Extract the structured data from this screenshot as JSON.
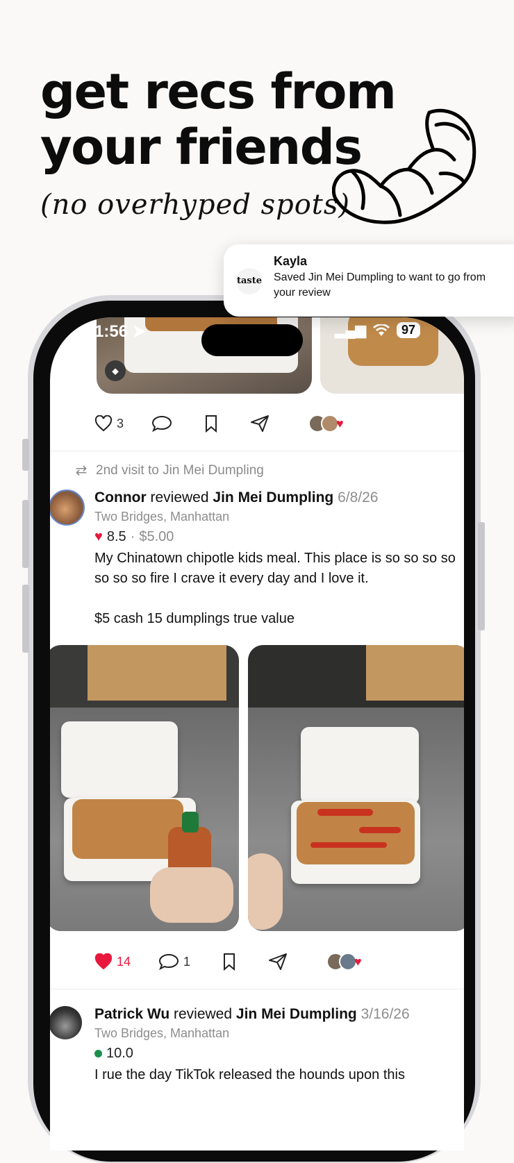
{
  "headline": {
    "line1": "get recs from",
    "line2": "your friends",
    "subline": "(no overhyped spots)"
  },
  "notification": {
    "app": "taste",
    "title": "Kayla",
    "message": "Saved Jin Mei Dumpling to want to go from your review"
  },
  "status_bar": {
    "time": "1:56",
    "battery": "97"
  },
  "first_post": {
    "likes": "3"
  },
  "second_post": {
    "repost_label": "2nd visit to Jin Mei Dumpling",
    "user": "Connor",
    "verb": "reviewed",
    "place": "Jin Mei Dumpling",
    "date": "6/8/26",
    "location": "Two Bridges, Manhattan",
    "score": "8.5",
    "separator": "·",
    "price": "$5.00",
    "text": "My Chinatown chipotle kids meal. This place is so so so so so so so fire I crave it every day and I love it.",
    "text2": "$5 cash 15 dumplings true value",
    "likes": "14",
    "comments": "1"
  },
  "third_post": {
    "user": "Patrick Wu",
    "verb": "reviewed",
    "place": "Jin Mei Dumpling",
    "date": "3/16/26",
    "location": "Two Bridges, Manhattan",
    "score": "10.0",
    "text": "I rue the day TikTok released the hounds upon this"
  },
  "colors": {
    "accent": "#e8193c",
    "green": "#1a8f4a",
    "muted": "#8d8d8d"
  }
}
